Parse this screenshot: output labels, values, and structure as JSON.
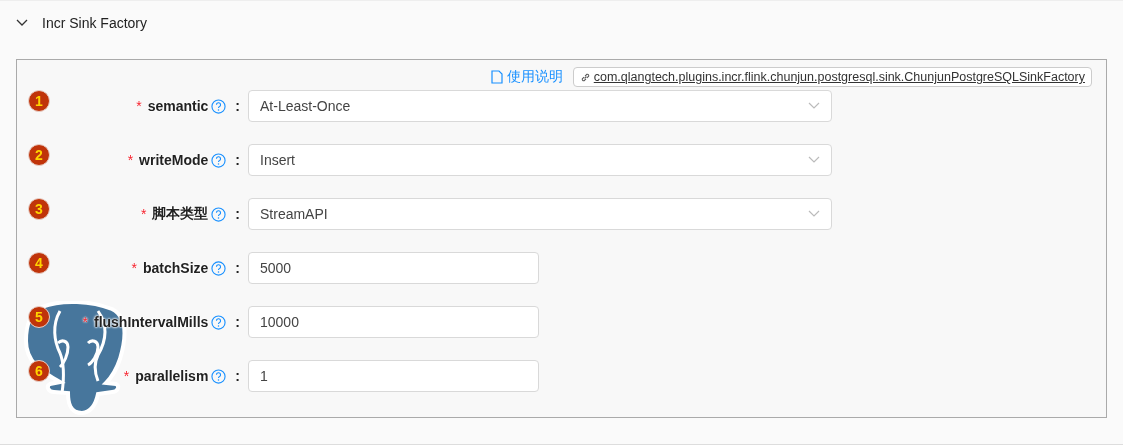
{
  "section": {
    "title": "Incr Sink Factory",
    "expanded": true
  },
  "panel": {
    "doc_link": "使用说明",
    "class_link": "com.qlangtech.plugins.incr.flink.chunjun.postgresql.sink.ChunjunPostgreSQLSinkFactory"
  },
  "fields": [
    {
      "number": "1",
      "required_mark": "*",
      "label": "semantic",
      "colon": ":",
      "kind": "select",
      "value": "At-Least-Once"
    },
    {
      "number": "2",
      "required_mark": "*",
      "label": "writeMode",
      "colon": ":",
      "kind": "select",
      "value": "Insert"
    },
    {
      "number": "3",
      "required_mark": "*",
      "label": "脚本类型",
      "colon": ":",
      "kind": "select",
      "value": "StreamAPI"
    },
    {
      "number": "4",
      "required_mark": "*",
      "label": "batchSize",
      "colon": ":",
      "kind": "input",
      "value": "5000"
    },
    {
      "number": "5",
      "required_mark": "*",
      "label": "flushIntervalMills",
      "colon": ":",
      "kind": "input",
      "value": "10000"
    },
    {
      "number": "6",
      "required_mark": "*",
      "label": "parallelism",
      "colon": ":",
      "kind": "input",
      "value": "1"
    }
  ]
}
